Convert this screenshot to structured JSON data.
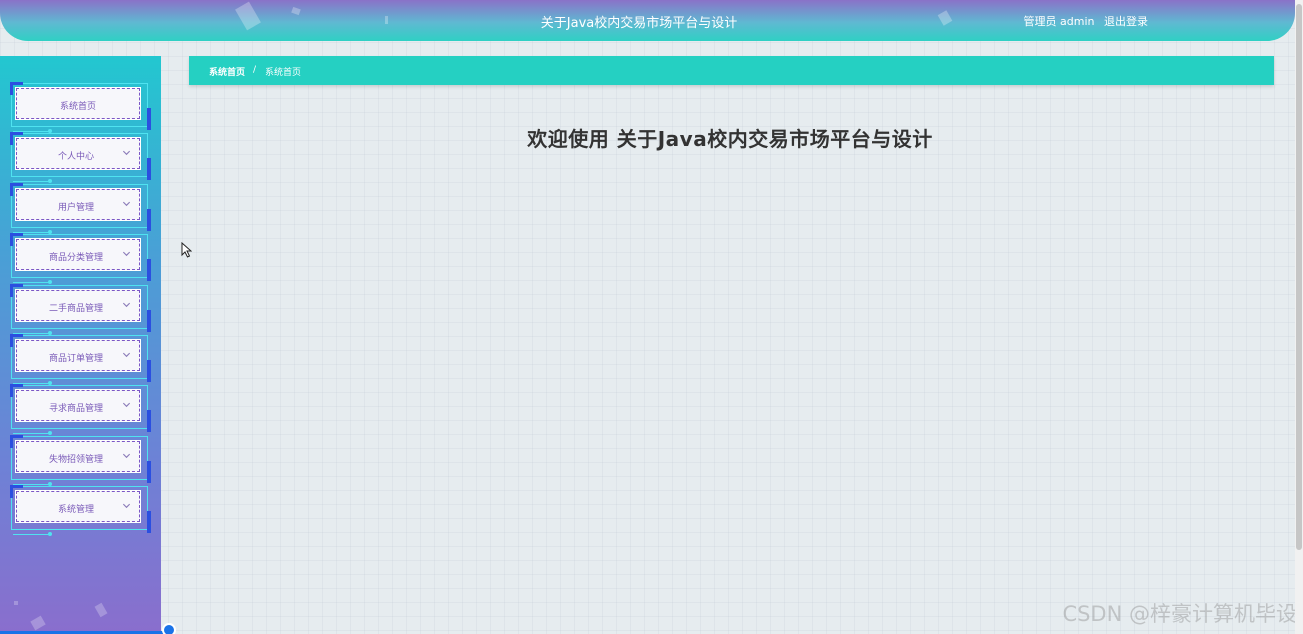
{
  "header": {
    "title": "关于Java校内交易市场平台与设计",
    "role_label": "管理员 admin",
    "logout_label": "退出登录"
  },
  "sidebar": {
    "items": [
      {
        "label": "系统首页",
        "has_arrow": false
      },
      {
        "label": "个人中心",
        "has_arrow": true
      },
      {
        "label": "用户管理",
        "has_arrow": true
      },
      {
        "label": "商品分类管理",
        "has_arrow": true
      },
      {
        "label": "二手商品管理",
        "has_arrow": true
      },
      {
        "label": "商品订单管理",
        "has_arrow": true
      },
      {
        "label": "寻求商品管理",
        "has_arrow": true
      },
      {
        "label": "失物招领管理",
        "has_arrow": true
      },
      {
        "label": "系统管理",
        "has_arrow": true
      }
    ]
  },
  "breadcrumb": {
    "home": "系统首页",
    "separator": "/",
    "current": "系统首页"
  },
  "main": {
    "welcome": "欢迎使用 关于Java校内交易市场平台与设计"
  },
  "watermark": "CSDN @梓豪计算机毕设",
  "colors": {
    "header_gradient_start": "#8a72c8",
    "header_gradient_end": "#2fd0c4",
    "breadcrumb_bg": "#25d0c2",
    "menu_text": "#7a5ab8",
    "menu_corner": "#2b4fe0",
    "menu_frame": "#4fe3f0"
  }
}
